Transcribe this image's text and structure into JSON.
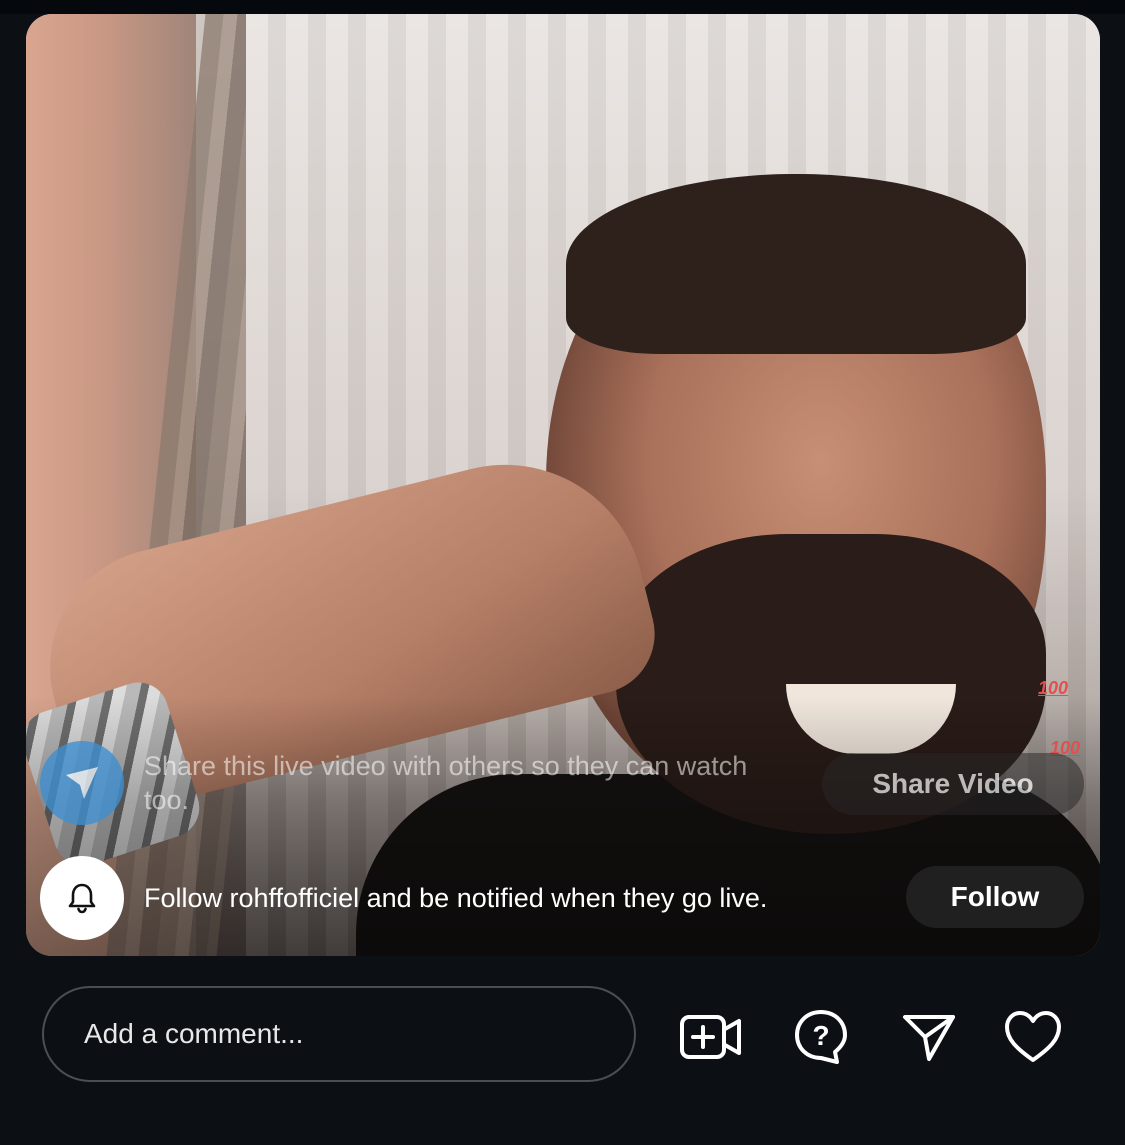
{
  "overlay": {
    "share_message": "Share this live video with others so they can watch too.",
    "share_button": "Share Video",
    "follow_message": "Follow rohffofficiel and be notified when they go live.",
    "follow_button": "Follow",
    "reaction_emoji": [
      "100",
      "100"
    ]
  },
  "bottom_bar": {
    "comment_placeholder": "Add a comment...",
    "icons": [
      "add-video-icon",
      "question-icon",
      "send-icon",
      "heart-icon"
    ]
  },
  "colors": {
    "background": "#0c1015",
    "share_avatar": "#3f8fd0",
    "bell_avatar": "#ffffff",
    "pill": "#282828"
  }
}
